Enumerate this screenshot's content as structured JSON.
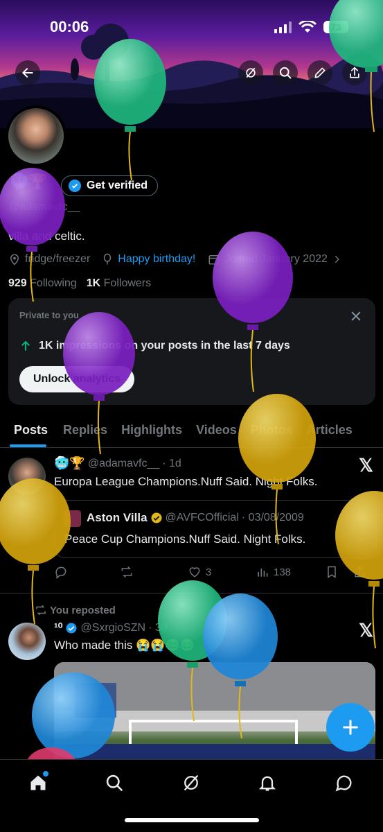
{
  "status": {
    "time": "00:06",
    "battery": "73"
  },
  "profile": {
    "handle": "@adamavfc__",
    "name_emojis": "🥶🏆",
    "get_verified": "Get verified",
    "bio": "villa and celtic.",
    "location": "fridge/freezer",
    "birthday": "Happy birthday!",
    "joined": "Joined January 2022",
    "following_count": "929",
    "following_label": "Following",
    "followers_count": "1K",
    "followers_label": "Followers"
  },
  "private_card": {
    "title": "Private to you",
    "impressions": "1K impressions on your posts in the last 7 days",
    "unlock": "Unlock analytics"
  },
  "tabs": [
    "Posts",
    "Replies",
    "Highlights",
    "Videos",
    "Photos",
    "Articles"
  ],
  "posts": [
    {
      "emojis": "🥶🏆",
      "handle": "@adamavfc__",
      "time": "· 1d",
      "text": "Europa League Champions.Nuff Said. Night Folks.",
      "quote": {
        "name": "Aston Villa",
        "handle": "@AVFCOfficial",
        "date": "· 03/08/2009",
        "text": "Peace Cup Champions.Nuff Said. Night Folks."
      },
      "likes": "3",
      "views": "138"
    },
    {
      "repost_label": "You reposted",
      "name": "¹⁰",
      "handle": "@SxrgioSZN",
      "time": "· 3d",
      "text": "Who made this 😭😭😂😂"
    }
  ],
  "colors": {
    "accent": "#1d9bf0",
    "background": "#000000",
    "card": "#16181c",
    "muted": "#71767b"
  }
}
